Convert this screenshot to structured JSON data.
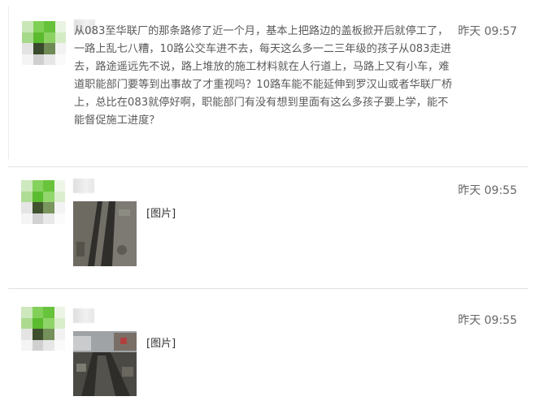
{
  "messages": [
    {
      "time": "昨天 09:57",
      "text": "从083至华联厂的那条路修了近一个月，基本上把路边的盖板掀开后就停工了，一路上乱七八糟，10路公交车进不去，每天这么多一二三年级的孩子从083走进去，路途遥远先不说，路上堆放的施工材料就在人行道上，马路上又有小车，难道职能部门要等到出事故了才重视吗？10路车能不能延伸到罗汉山或者华联厂桥上，总比在083就停好啊，职能部门有没有想到里面有这么多孩子要上学，能不能督促施工进度？"
    },
    {
      "time": "昨天 09:55",
      "image_label": "[图片]"
    },
    {
      "time": "昨天 09:55",
      "image_label": "[图片]"
    }
  ]
}
